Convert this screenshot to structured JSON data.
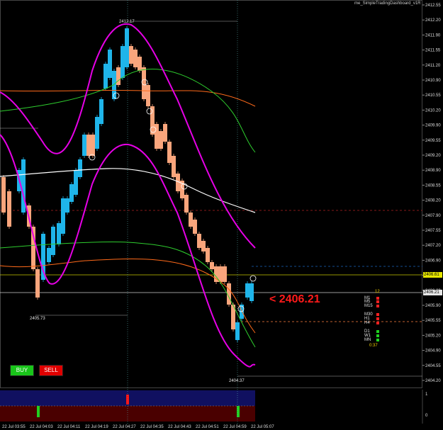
{
  "header": {
    "indicator_title": "me_SimpleTradingDashboard_v1R"
  },
  "buttons": {
    "buy": "BUY",
    "sell": "SELL"
  },
  "current_price_big": "< 2406.21",
  "labels": {
    "high": "2412.17",
    "mid_low": "2405.73",
    "low": "2404.37"
  },
  "price_axis": [
    "2412.55",
    "2412.20",
    "2411.90",
    "2411.55",
    "2411.20",
    "2410.90",
    "2410.55",
    "2410.20",
    "2409.90",
    "2409.55",
    "2409.20",
    "2408.90",
    "2408.55",
    "2408.20",
    "2407.90",
    "2407.55",
    "2407.20",
    "2406.90",
    "2406.55",
    "2406.20",
    "2405.90",
    "2405.55",
    "2405.20",
    "2404.90",
    "2404.55",
    "2404.20"
  ],
  "price_tags": {
    "yellow": "2406.61",
    "white": "2406.21"
  },
  "time_axis": [
    "22 Jul 03:55",
    "22 Jul 04:03",
    "22 Jul 04:11",
    "22 Jul 04:19",
    "22 Jul 04:27",
    "22 Jul 04:35",
    "22 Jul 04:43",
    "22 Jul 04:51",
    "22 Jul 04:59",
    "22 Jul 05:07"
  ],
  "sub_axis": [
    "1",
    "0"
  ],
  "timeframes": [
    {
      "label": "M1",
      "color": "#ff2020"
    },
    {
      "label": "M5",
      "color": "#ff2020"
    },
    {
      "label": "M15",
      "color": "#ff2020"
    },
    {
      "label": "M30",
      "color": "#ff2020"
    },
    {
      "label": "H1",
      "color": "#ff2020"
    },
    {
      "label": "H4",
      "color": "#ff2020"
    },
    {
      "label": "D1",
      "color": "#20d020"
    },
    {
      "label": "W1",
      "color": "#20d020"
    },
    {
      "label": "MN",
      "color": "#20d020"
    }
  ],
  "timeframe_extra": {
    "top": "12",
    "timer": "0:37"
  },
  "colors": {
    "bull": "#1fb5ea",
    "bear": "#f9a57c",
    "magenta": "#e600e6",
    "orange": "#ff6a1a",
    "green": "#2ecc2e",
    "white_ma": "#ffffff"
  }
}
